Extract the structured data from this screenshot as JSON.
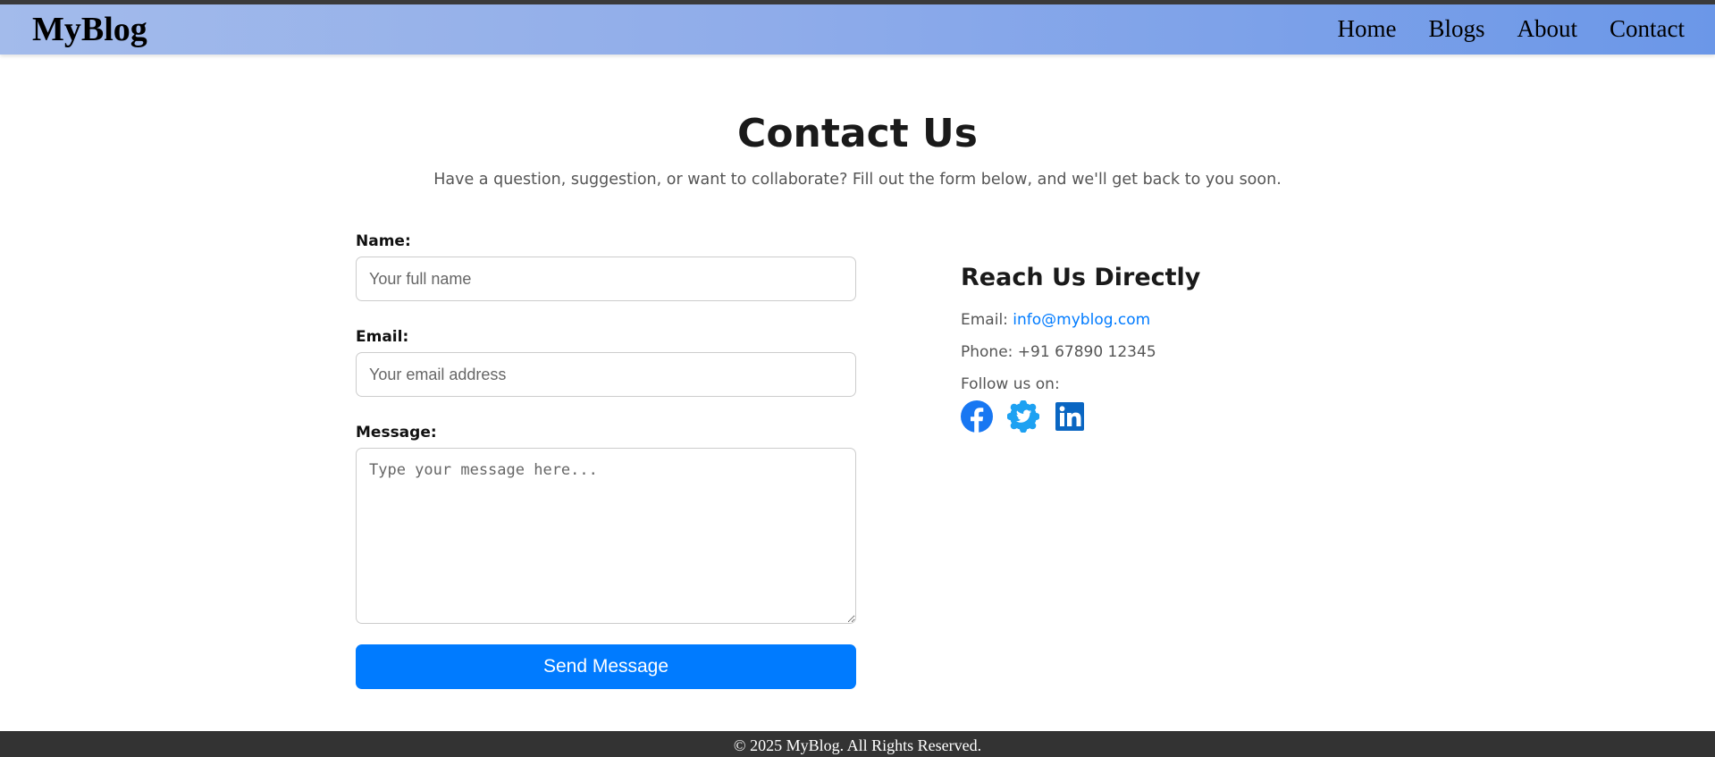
{
  "header": {
    "logo": "MyBlog",
    "nav": [
      {
        "label": "Home"
      },
      {
        "label": "Blogs"
      },
      {
        "label": "About"
      },
      {
        "label": "Contact"
      }
    ],
    "gradient_colors": [
      "#a3bbeb",
      "#6b97e8"
    ]
  },
  "main": {
    "title": "Contact Us",
    "subtitle": "Have a question, suggestion, or want to collaborate? Fill out the form below, and we'll get back to you soon."
  },
  "form": {
    "name_label": "Name:",
    "name_placeholder": "Your full name",
    "email_label": "Email:",
    "email_placeholder": "Your email address",
    "message_label": "Message:",
    "message_placeholder": "Type your message here...",
    "submit_label": "Send Message",
    "accent_color": "#007bff"
  },
  "reach": {
    "title": "Reach Us Directly",
    "email_prefix": "Email: ",
    "email": "info@myblog.com",
    "phone": "Phone: +91 67890 12345",
    "follow": "Follow us on:",
    "socials": [
      {
        "icon": "facebook-icon",
        "color": "#1877f2"
      },
      {
        "icon": "twitter-icon",
        "color": "#1da1f2"
      },
      {
        "icon": "linkedin-icon",
        "color": "#0a66c2"
      }
    ]
  },
  "footer": {
    "text": "© 2025 MyBlog. All Rights Reserved."
  }
}
